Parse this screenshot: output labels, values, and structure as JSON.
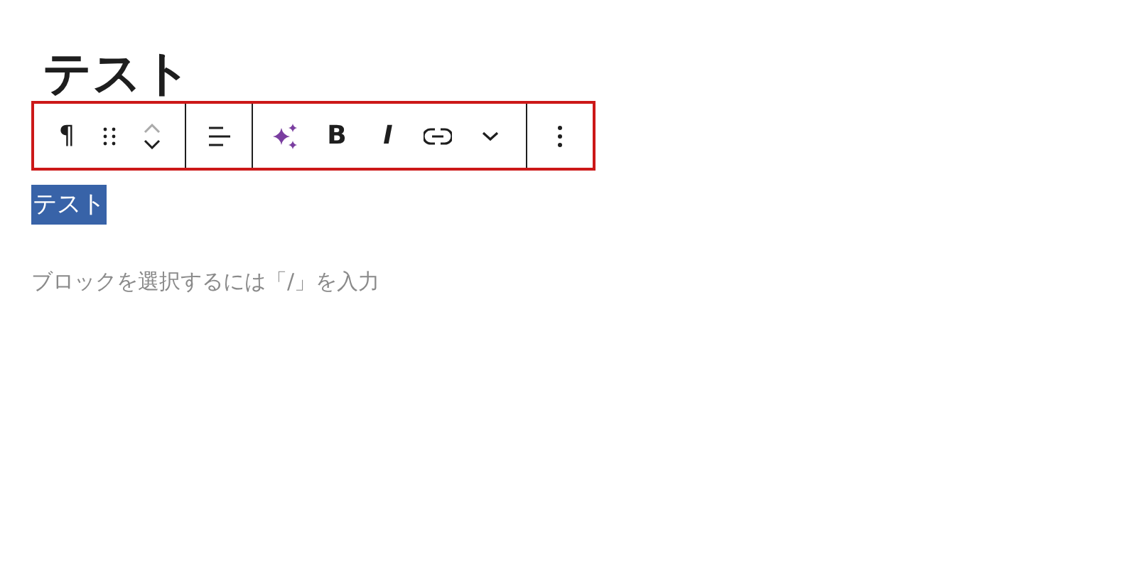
{
  "heading": "テスト",
  "toolbar": {
    "groups": [
      {
        "items": [
          {
            "kind": "paragraph",
            "label": "¶"
          },
          {
            "kind": "drag"
          },
          {
            "kind": "mover"
          }
        ]
      },
      {
        "items": [
          {
            "kind": "align"
          }
        ]
      },
      {
        "items": [
          {
            "kind": "sparkle"
          },
          {
            "kind": "bold",
            "label": "B"
          },
          {
            "kind": "italic",
            "label": "I"
          },
          {
            "kind": "link"
          },
          {
            "kind": "chevron"
          }
        ]
      },
      {
        "items": [
          {
            "kind": "more"
          }
        ]
      }
    ]
  },
  "paragraph": {
    "text": "テスト",
    "selected": true
  },
  "appender": {
    "placeholder": "ブロックを選択するには「/」を入力"
  }
}
